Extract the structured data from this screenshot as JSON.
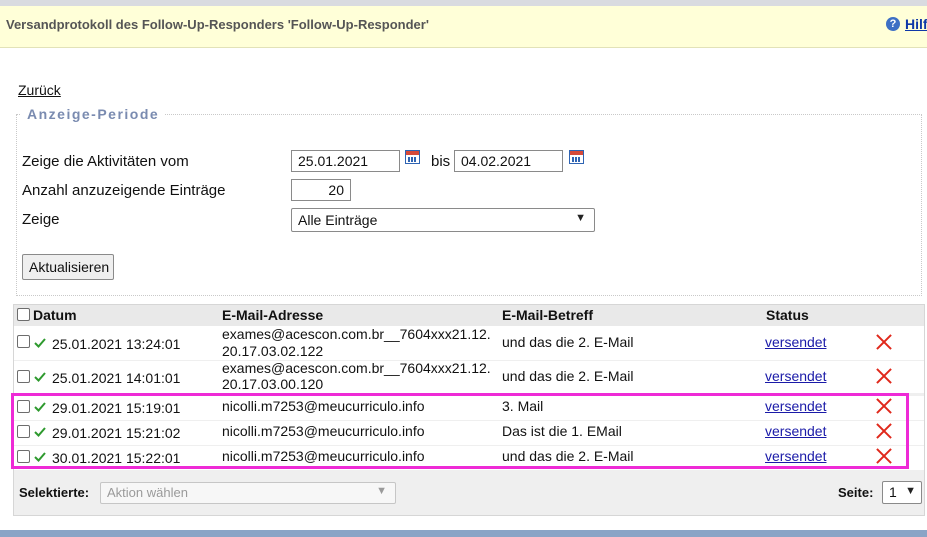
{
  "header": {
    "title": "Versandprotokoll des Follow-Up-Responders 'Follow-Up-Responder'",
    "help_label": "Hilfe"
  },
  "nav": {
    "back_label": "Zurück"
  },
  "period": {
    "legend": "Anzeige-Periode",
    "from_label": "Zeige die Aktivitäten vom",
    "from_value": "25.01.2021",
    "to_label": "bis",
    "to_value": "04.02.2021",
    "count_label": "Anzahl anzuzeigende Einträge",
    "count_value": "20",
    "show_label": "Zeige",
    "show_value": "Alle Einträge",
    "update_label": "Aktualisieren"
  },
  "table": {
    "columns": {
      "date": "Datum",
      "email": "E-Mail-Adresse",
      "subject": "E-Mail-Betreff",
      "status": "Status"
    },
    "rows": [
      {
        "date": "25.01.2021 13:24:01",
        "email_line1": "exames@acescon.com.br__7604xxx21.12.",
        "email_line2": "20.17.03.02.122",
        "subject": "und das die 2. E-Mail",
        "status": "versendet"
      },
      {
        "date": "25.01.2021 14:01:01",
        "email_line1": "exames@acescon.com.br__7604xxx21.12.",
        "email_line2": "20.17.03.00.120",
        "subject": "und das die 2. E-Mail",
        "status": "versendet"
      },
      {
        "date": "29.01.2021 15:19:01",
        "email_line1": "nicolli.m7253@meucurriculo.info",
        "email_line2": "",
        "subject": "3. Mail",
        "status": "versendet"
      },
      {
        "date": "29.01.2021 15:21:02",
        "email_line1": "nicolli.m7253@meucurriculo.info",
        "email_line2": "",
        "subject": "Das ist die 1. EMail",
        "status": "versendet"
      },
      {
        "date": "30.01.2021 15:22:01",
        "email_line1": "nicolli.m7253@meucurriculo.info",
        "email_line2": "",
        "subject": "und das die 2. E-Mail",
        "status": "versendet"
      }
    ]
  },
  "footer": {
    "selected_label": "Selektierte:",
    "action_placeholder": "Aktion wählen",
    "page_label": "Seite:",
    "page_value": "1"
  },
  "colors": {
    "highlight": "#ee2ad6",
    "delete": "#e0281b",
    "check": "#2e9a2e",
    "header_bg": "#ffffd8"
  },
  "icons": {
    "help": "help-icon",
    "calendar": "calendar-icon",
    "check": "check-icon",
    "delete": "delete-icon"
  }
}
